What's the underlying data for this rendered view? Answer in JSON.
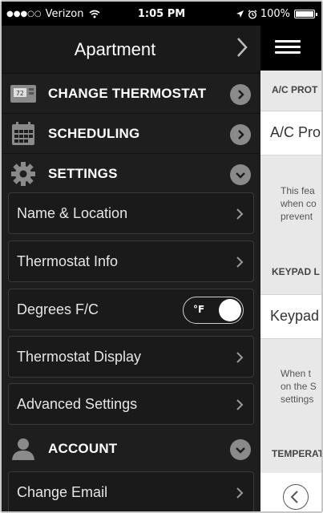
{
  "status_bar": {
    "signal": "●●●○○",
    "carrier": "Verizon",
    "time": "1:05 PM",
    "battery": "100%"
  },
  "sidebar": {
    "title": "Apartment",
    "sections": {
      "change_thermostat": "CHANGE THERMOSTAT",
      "thermostat_icon_text": "72",
      "scheduling": "SCHEDULING",
      "settings": "SETTINGS",
      "account": "ACCOUNT"
    },
    "settings_items": [
      {
        "label": "Name & Location"
      },
      {
        "label": "Thermostat Info"
      },
      {
        "label": "Degrees F/C",
        "toggle_value": "°F"
      },
      {
        "label": "Thermostat Display"
      },
      {
        "label": "Advanced Settings"
      }
    ],
    "account_items": [
      {
        "label": "Change Email"
      }
    ]
  },
  "panel": {
    "headers": [
      "A/C PROT",
      "KEYPAD L",
      "TEMPERAT"
    ],
    "rows": [
      "A/C Pro",
      "Keypad"
    ],
    "notes": {
      "ac": [
        "This fea",
        "when co",
        "prevent"
      ],
      "keypad": [
        "When t",
        "on the S",
        "settings"
      ]
    }
  },
  "colors": {
    "sidebar_bg": "#1e1e1e",
    "header_bg": "#1a1a1a",
    "accent_circle": "#8a8a8a",
    "panel_bg": "#e8e8e8"
  }
}
